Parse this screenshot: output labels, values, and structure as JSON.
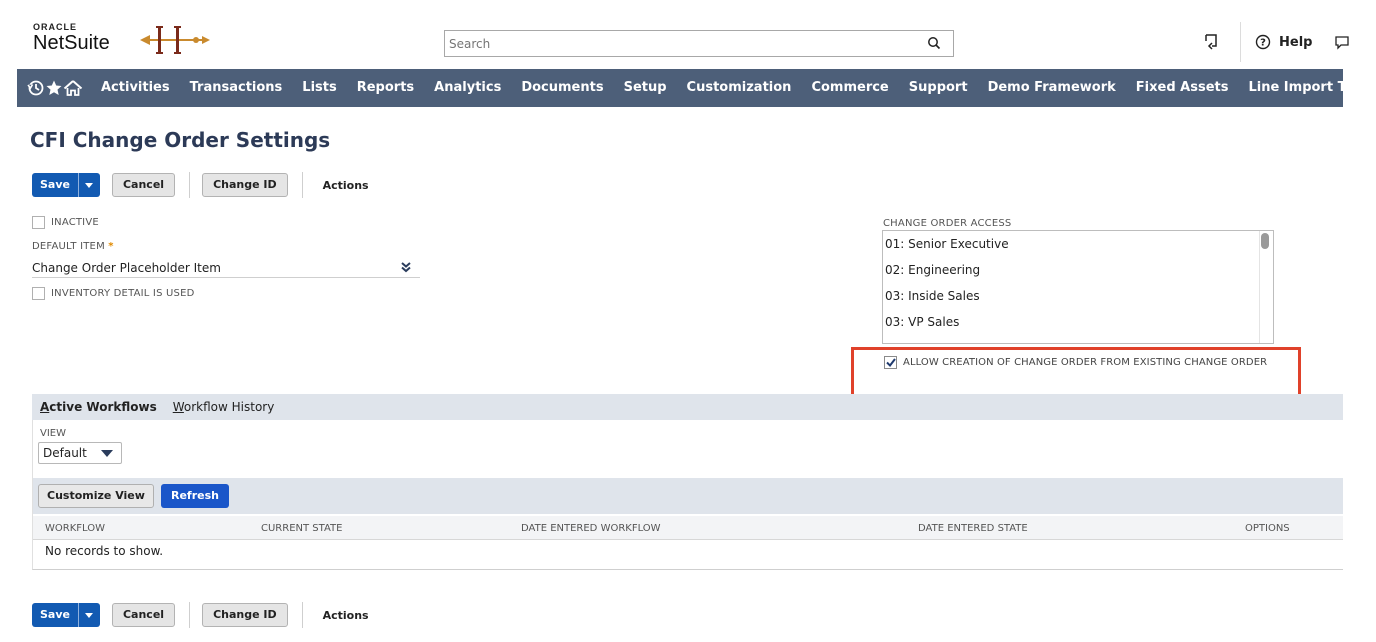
{
  "header": {
    "logo_top": "ORACLE",
    "logo_bottom": "NetSuite",
    "search_placeholder": "Search",
    "help_label": "Help"
  },
  "nav": {
    "icons": [
      "recent-icon",
      "star-icon",
      "home-icon"
    ],
    "items": [
      "Activities",
      "Transactions",
      "Lists",
      "Reports",
      "Analytics",
      "Documents",
      "Setup",
      "Customization",
      "Commerce",
      "Support",
      "Demo Framework",
      "Fixed Assets",
      "Line Import Tool"
    ]
  },
  "page": {
    "title": "CFI Change Order Settings"
  },
  "buttons": {
    "save": "Save",
    "cancel": "Cancel",
    "change_id": "Change ID",
    "actions": "Actions"
  },
  "form": {
    "inactive_label": "INACTIVE",
    "default_item_label": "DEFAULT ITEM",
    "default_item_required": "*",
    "default_item_value": "Change Order Placeholder Item",
    "inventory_detail_label": "INVENTORY DETAIL IS USED",
    "change_order_access_label": "CHANGE ORDER ACCESS",
    "change_order_access_options": [
      "01: Senior Executive",
      "02: Engineering",
      "03: Inside Sales",
      "03: VP Sales"
    ],
    "allow_creation_label": "ALLOW CREATION OF CHANGE ORDER FROM EXISTING CHANGE ORDER",
    "allow_creation_checked": true,
    "highlight_color": "#e0412a"
  },
  "workflows": {
    "tabs": [
      {
        "label": "Active Workflows",
        "underline": "A",
        "rest": "ctive Workflows"
      },
      {
        "label": "Workflow History",
        "underline": "W",
        "rest": "orkflow History"
      }
    ],
    "view_label": "VIEW",
    "view_value": "Default",
    "customize_view": "Customize View",
    "refresh": "Refresh",
    "columns": [
      "WORKFLOW",
      "CURRENT STATE",
      "DATE ENTERED WORKFLOW",
      "DATE ENTERED STATE",
      "OPTIONS"
    ],
    "empty_message": "No records to show."
  },
  "colors": {
    "nav_bg": "#4d5f79",
    "primary_button": "#125ab2",
    "title": "#2c3a57"
  }
}
